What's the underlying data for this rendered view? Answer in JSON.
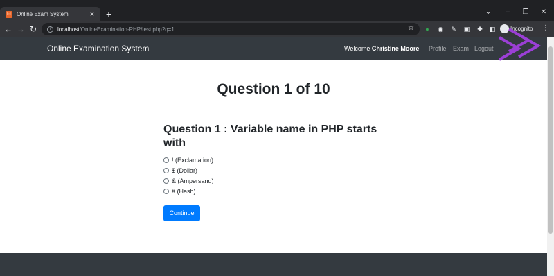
{
  "browser": {
    "tab_title": "Online Exam System",
    "tab_close": "×",
    "new_tab": "+",
    "url_host": "localhost",
    "url_path": "/OnlineExamination-PHP/test.php?q=1",
    "incognito_label": "Incognito",
    "controls": {
      "minimize": "–",
      "maximize": "❐",
      "close": "✕",
      "dropdown": "⌄"
    }
  },
  "navbar": {
    "brand": "Online Examination System",
    "welcome_prefix": "Welcome ",
    "user_name": "Christine Moore",
    "links": [
      "Profile",
      "Exam",
      "Logout"
    ]
  },
  "exam": {
    "heading": "Question 1 of 10",
    "question": "Question 1 : Variable name in PHP starts with",
    "options": [
      "! (Exclamation)",
      "$ (Dollar)",
      "& (Ampersand)",
      "# (Hash)"
    ],
    "continue_label": "Continue"
  },
  "colors": {
    "navbar_bg": "#343a40",
    "primary": "#007bff",
    "accent_arrows": "#9b3fd6"
  }
}
